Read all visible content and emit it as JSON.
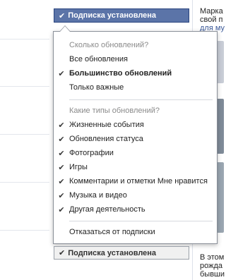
{
  "sidebar_right": {
    "lines_top": [
      "Марка",
      "свой п",
      "для му"
    ],
    "lines_bottom": [
      "В этом",
      "рожда",
      "бывши"
    ]
  },
  "subscribe_button": {
    "label": "Подписка установлена",
    "check_icon": "check-icon"
  },
  "menu": {
    "section_frequency_header": "Сколько обновлений?",
    "frequency_options": [
      {
        "label": "Все обновления",
        "selected": false
      },
      {
        "label": "Большинство обновлений",
        "selected": true
      },
      {
        "label": "Только важные",
        "selected": false
      }
    ],
    "section_types_header": "Какие типы обновлений?",
    "type_options": [
      {
        "label": "Жизненные события",
        "checked": true
      },
      {
        "label": "Обновления статуса",
        "checked": true
      },
      {
        "label": "Фотографии",
        "checked": true
      },
      {
        "label": "Игры",
        "checked": true
      },
      {
        "label": "Комментарии и отметки Мне нравится",
        "checked": true
      },
      {
        "label": "Музыка и видео",
        "checked": true
      },
      {
        "label": "Другая деятельность",
        "checked": true
      }
    ],
    "unsubscribe_label": "Отказаться от подписки"
  },
  "colors": {
    "button_blue": "#5b74a8",
    "button_border": "#29447e",
    "link_blue": "#3b5998"
  }
}
